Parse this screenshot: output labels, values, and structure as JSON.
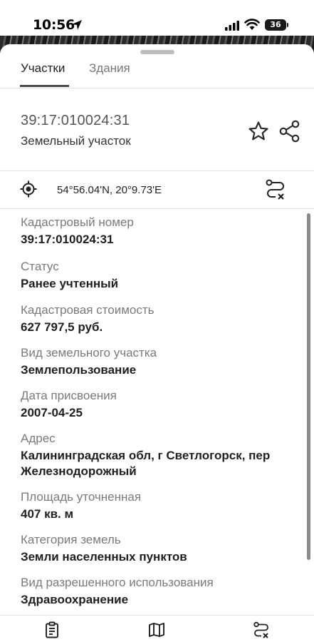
{
  "status_bar": {
    "time": "10:56",
    "battery": "36"
  },
  "tabs": [
    {
      "label": "Участки",
      "active": true
    },
    {
      "label": "Здания",
      "active": false
    }
  ],
  "parcel": {
    "number": "39:17:010024:31",
    "type": "Земельный участок"
  },
  "location": {
    "coordinates": "54°56.04'N, 20°9.73'E"
  },
  "fields": [
    {
      "label": "Кадастровый номер",
      "value": "39:17:010024:31"
    },
    {
      "label": "Статус",
      "value": "Ранее учтенный"
    },
    {
      "label": "Кадастровая стоимость",
      "value": "627 797,5 руб."
    },
    {
      "label": "Вид земельного участка",
      "value": "Землепользование"
    },
    {
      "label": "Дата присвоения",
      "value": "2007-04-25"
    },
    {
      "label": "Адрес",
      "value": "Калининградская обл, г Светлогорск, пер Железнодорожный"
    },
    {
      "label": "Площадь уточненная",
      "value": "407 кв. м"
    },
    {
      "label": "Категория земель",
      "value": "Земли населенных пунктов"
    },
    {
      "label": "Вид разрешенного использования",
      "value": "Здравоохранение"
    }
  ],
  "icons": {
    "star": "star-icon",
    "share": "share-icon",
    "locate": "crosshair-icon",
    "route": "route-clear-icon",
    "nav_list": "clipboard-list-icon",
    "nav_map": "map-icon",
    "nav_route": "route-clear-icon"
  },
  "colors": {
    "text_primary": "#1f1f1f",
    "text_secondary": "#7a7a7a",
    "divider": "#e3e3e3",
    "tab_indicator": "#4a4a4a"
  }
}
